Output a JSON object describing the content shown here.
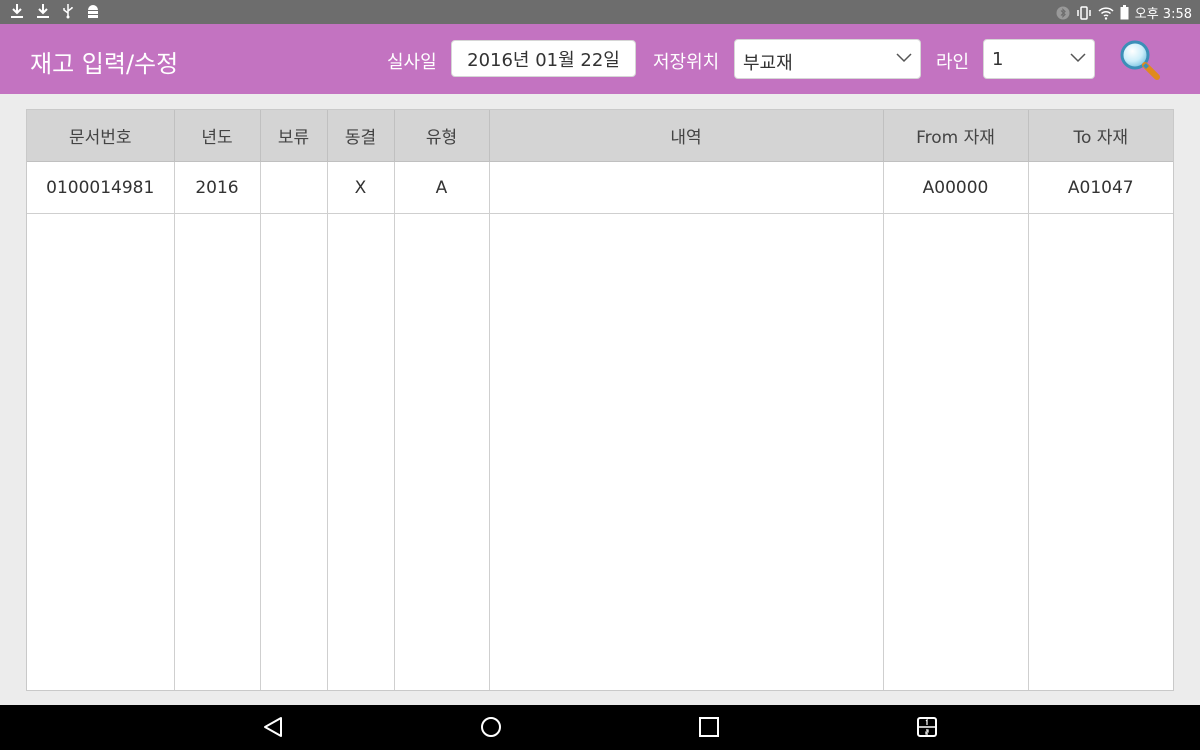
{
  "status_bar": {
    "time": "오후 3:58",
    "left_icons": [
      "download-icon",
      "download-icon",
      "usb-icon",
      "android-debug-icon"
    ],
    "right_icons": [
      "bluetooth-icon",
      "vibrate-icon",
      "wifi-icon",
      "battery-icon"
    ]
  },
  "header": {
    "title": "재고 입력/수정",
    "date_label": "실사일",
    "date_value": "2016년 01월 22일",
    "location_label": "저장위치",
    "location_value": "부교재",
    "line_label": "라인",
    "line_value": "1",
    "search_icon": "search-icon"
  },
  "table": {
    "columns": [
      "문서번호",
      "년도",
      "보류",
      "동결",
      "유형",
      "내역",
      "From 자재",
      "To 자재"
    ],
    "rows": [
      [
        "0100014981",
        "2016",
        "",
        "X",
        "A",
        "",
        "A00000",
        "A01047"
      ]
    ]
  },
  "nav_bar": {
    "icons": [
      "back-icon",
      "home-icon",
      "recents-icon",
      "multiwindow-icon"
    ]
  },
  "colors": {
    "appbar": "#c373c1",
    "statusbar": "#6d6d6d",
    "header_cell": "#d4d4d4"
  }
}
